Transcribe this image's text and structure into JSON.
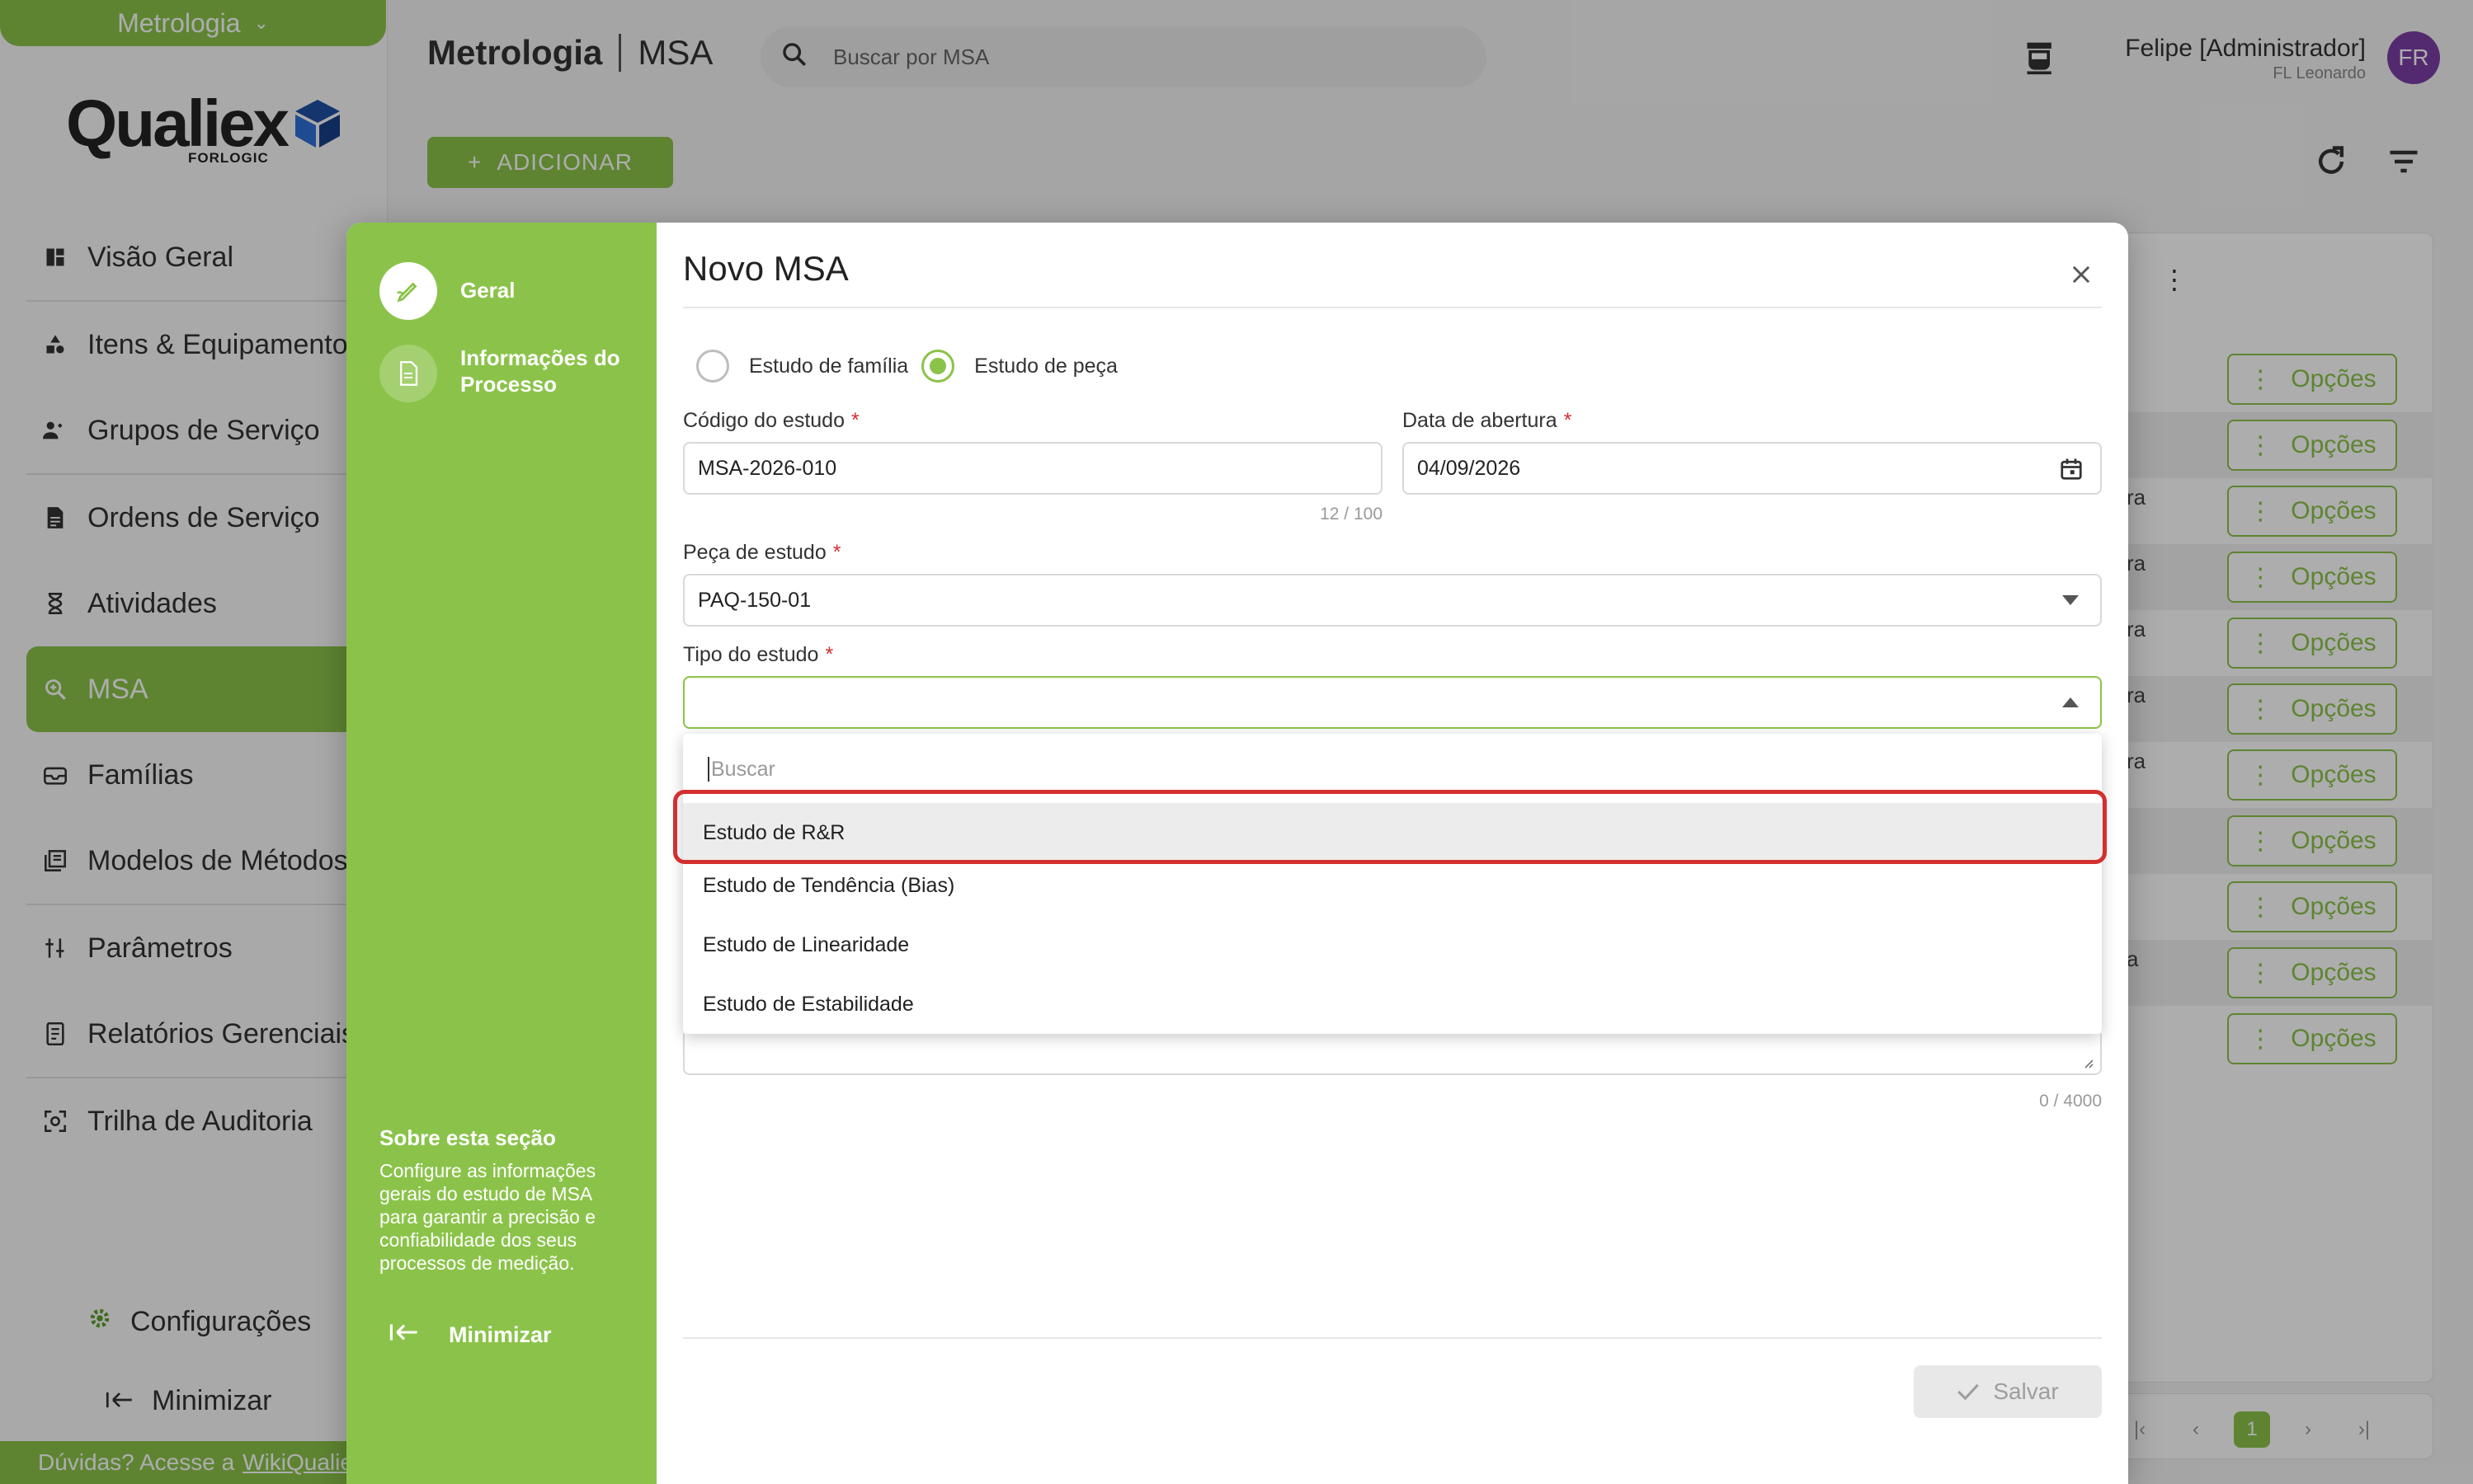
{
  "app": {
    "module": "Metrologia",
    "logo_text": "Qualiex",
    "logo_sub": "FORLOGIC"
  },
  "sidebar": {
    "items": [
      {
        "label": "Visão Geral",
        "icon": "dashboard-icon"
      },
      {
        "label": "Itens & Equipamentos",
        "icon": "shapes-icon"
      },
      {
        "label": "Grupos de Serviço",
        "icon": "group-icon"
      },
      {
        "label": "Ordens de Serviço",
        "icon": "document-icon"
      },
      {
        "label": "Atividades",
        "icon": "hourglass-icon"
      },
      {
        "label": "MSA",
        "icon": "zoom-icon",
        "active": true
      },
      {
        "label": "Famílias",
        "icon": "tray-icon"
      },
      {
        "label": "Modelos de Métodos",
        "icon": "library-icon"
      },
      {
        "label": "Parâmetros",
        "icon": "sliders-icon"
      },
      {
        "label": "Relatórios Gerenciais",
        "icon": "report-icon"
      },
      {
        "label": "Trilha de Auditoria",
        "icon": "audit-icon"
      }
    ],
    "settings_label": "Configurações",
    "minimize_label": "Minimizar",
    "help_text": "Dúvidas? Acesse a",
    "help_link": "WikiQualiex"
  },
  "header": {
    "breadcrumb_module": "Metrologia",
    "breadcrumb_page": "MSA",
    "search_placeholder": "Buscar por MSA",
    "user_name": "Felipe [Administrador]",
    "user_sub": "FL Leonardo",
    "avatar_initials": "FR"
  },
  "toolbar": {
    "add_label": "ADICIONAR"
  },
  "list": {
    "option_label": "Opções",
    "row_fragments": [
      "ra",
      "ra",
      "ra",
      "ra",
      "ra",
      "a"
    ],
    "current_page": "1"
  },
  "dialog": {
    "title": "Novo MSA",
    "steps": [
      {
        "label": "Geral",
        "icon": "pencil-icon",
        "active": true
      },
      {
        "label": "Informações do Processo",
        "icon": "document-icon",
        "active": false
      }
    ],
    "about_title": "Sobre esta seção",
    "about_text": "Configure as informações gerais do estudo de MSA para garantir a precisão e confiabilidade dos seus processos de medição.",
    "minimize_label": "Minimizar",
    "radio_family": "Estudo de família",
    "radio_part": "Estudo de peça",
    "radio_selected": "Estudo de peça",
    "code_label": "Código do estudo",
    "code_value": "MSA-2026-010",
    "code_counter": "12 / 100",
    "date_label": "Data de abertura",
    "date_value": "04/09/2026",
    "part_label": "Peça de estudo",
    "part_value": "PAQ-150-01",
    "type_label": "Tipo do estudo",
    "type_value": "",
    "dropdown_search_placeholder": "Buscar",
    "dropdown_options": [
      "Estudo de R&R",
      "Estudo de Tendência (Bias)",
      "Estudo de Linearidade",
      "Estudo de Estabilidade"
    ],
    "desc_counter": "0 / 4000",
    "save_label": "Salvar"
  },
  "colors": {
    "accent": "#8bc34a",
    "avatar": "#7b3fa6",
    "highlight_border": "#d32f2f"
  }
}
